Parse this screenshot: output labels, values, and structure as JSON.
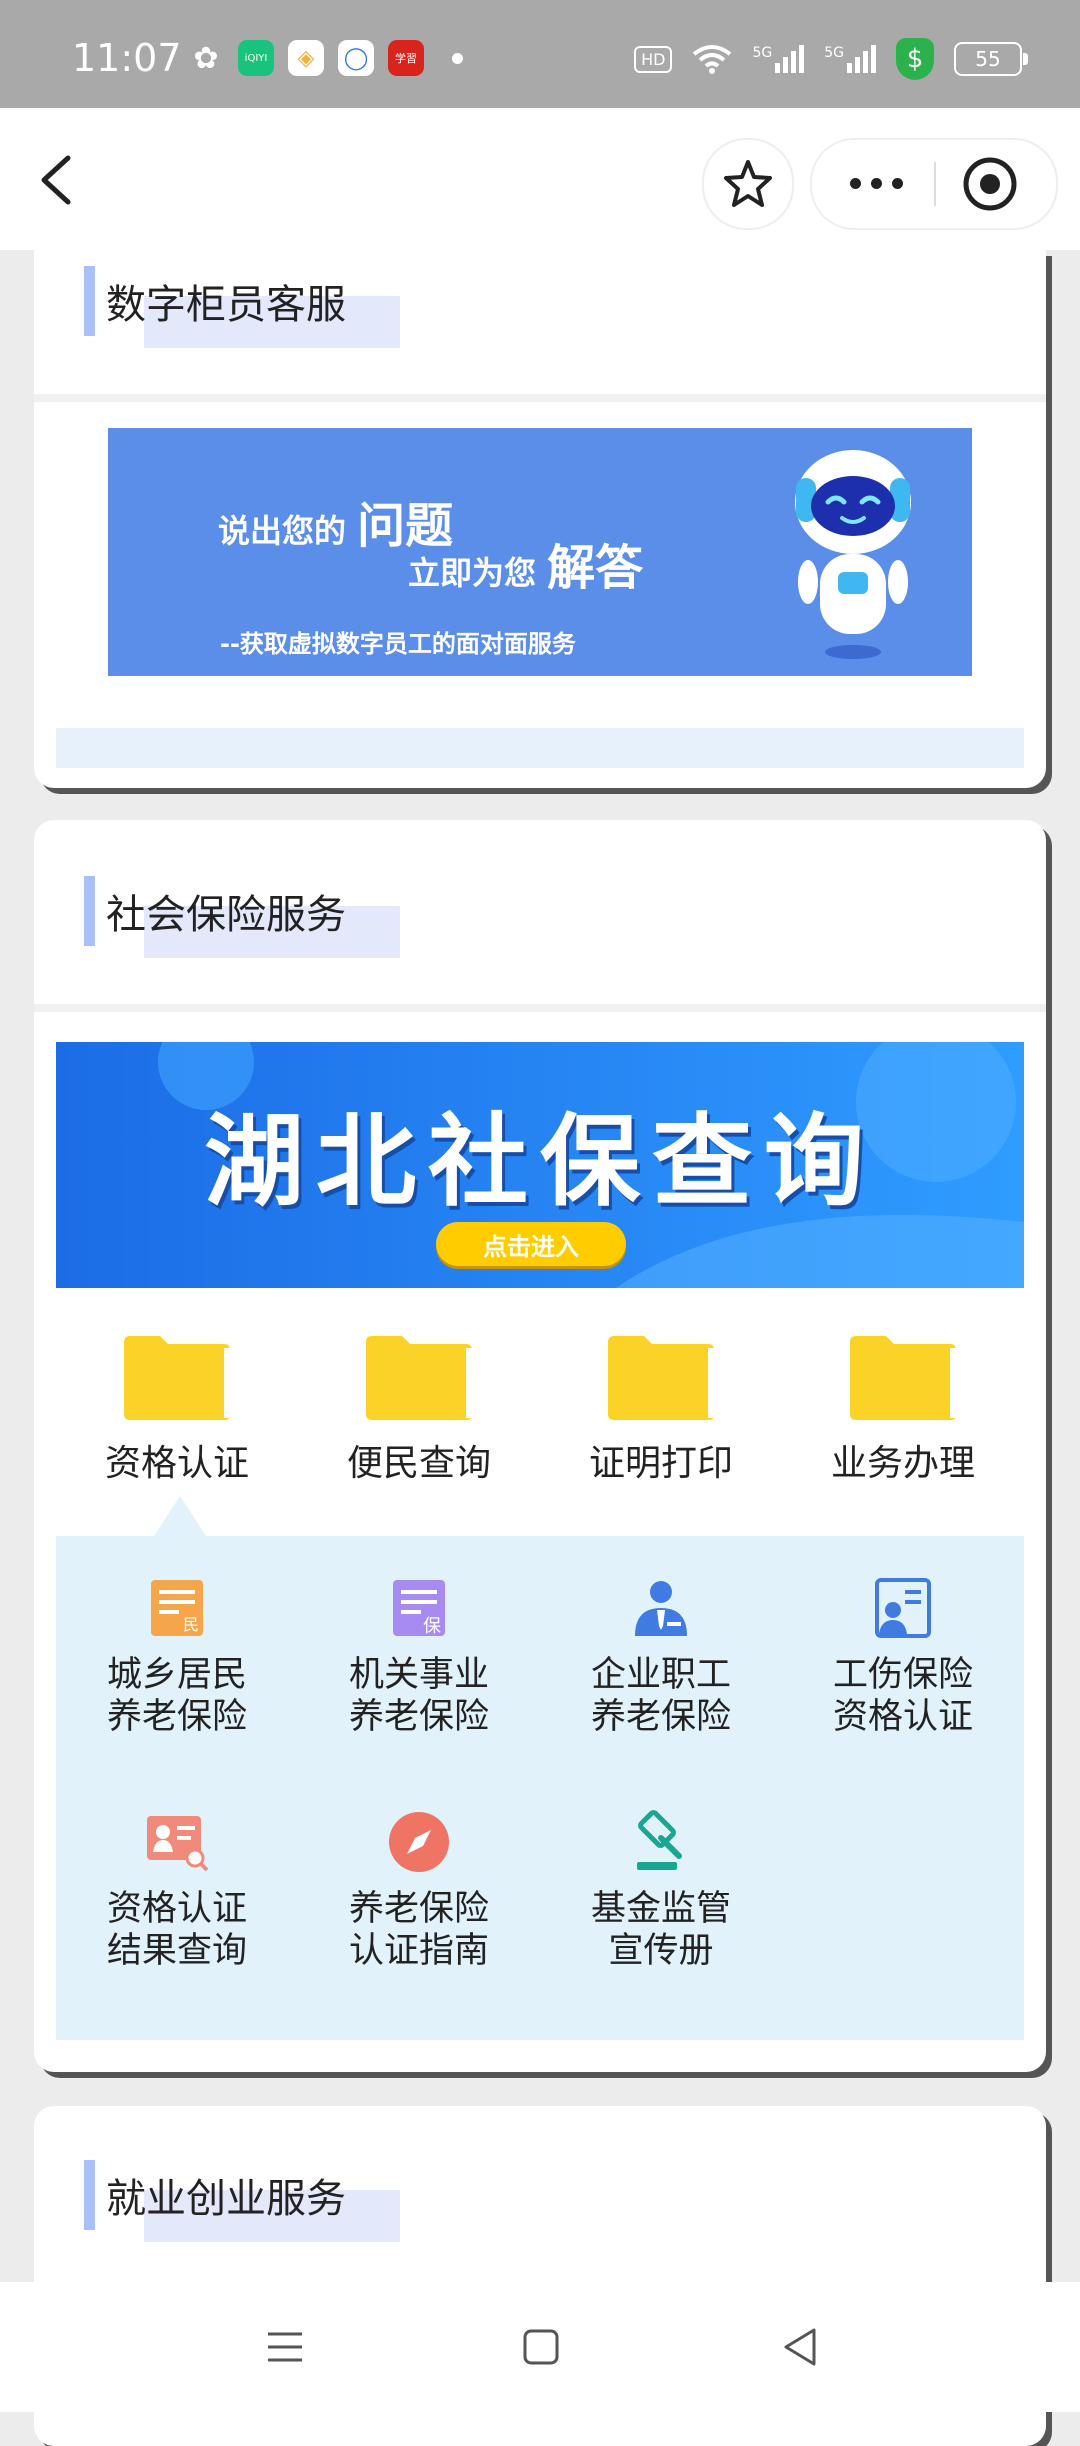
{
  "status_bar": {
    "time": "11:07",
    "apps": [
      {
        "name": "wechat",
        "glyph": "◉",
        "color": "#ffffff"
      },
      {
        "name": "iqiyi",
        "glyph": "iQIYI",
        "color": "#19c37d"
      },
      {
        "name": "album",
        "glyph": "◈",
        "color": "#f2b13b"
      },
      {
        "name": "chat",
        "glyph": "◯",
        "color": "#2a7de1"
      },
      {
        "name": "xuexi",
        "glyph": "学習",
        "color": "#d8241c"
      }
    ],
    "hd_label": "HD",
    "net1": "5G",
    "net2": "5G",
    "shield_glyph": "$",
    "battery": "55"
  },
  "nav": {
    "back_icon": "chevron-left",
    "favorite_icon": "star-outline",
    "more_icon": "ellipsis",
    "close_icon": "target"
  },
  "card1": {
    "title": "数字柜员客服",
    "banner": {
      "line1_prefix": "说出您的",
      "line1_emph": "问题",
      "line2_prefix": "立即为您",
      "line2_emph": "解答",
      "line3": "--获取虚拟数字员工的面对面服务"
    }
  },
  "card2": {
    "title": "社会保险服务",
    "banner": {
      "title": "湖北社保查询",
      "button": "点击进入"
    },
    "categories": [
      "资格认证",
      "便民查询",
      "证明打印",
      "业务办理"
    ],
    "sub_items": [
      {
        "line1": "城乡居民",
        "line2": "养老保险",
        "icon": "document-min-icon",
        "color": "#f5a54a"
      },
      {
        "line1": "机关事业",
        "line2": "养老保险",
        "icon": "document-bao-icon",
        "color": "#a78bf0"
      },
      {
        "line1": "企业职工",
        "line2": "养老保险",
        "icon": "business-person-icon",
        "color": "#3f7be0"
      },
      {
        "line1": "工伤保险",
        "line2": "资格认证",
        "icon": "id-card-icon",
        "color": "#3f7be0"
      },
      {
        "line1": "资格认证",
        "line2": "结果查询",
        "icon": "search-card-icon",
        "color": "#f08a7a"
      },
      {
        "line1": "养老保险",
        "line2": "认证指南",
        "icon": "compass-icon",
        "color": "#f07464"
      },
      {
        "line1": "基金监管",
        "line2": "宣传册",
        "icon": "gavel-icon",
        "color": "#17a793"
      }
    ]
  },
  "card3": {
    "title": "就业创业服务"
  },
  "bottom_nav": {
    "menu_icon": "hamburger",
    "home_icon": "square",
    "back_icon": "triangle-left"
  }
}
